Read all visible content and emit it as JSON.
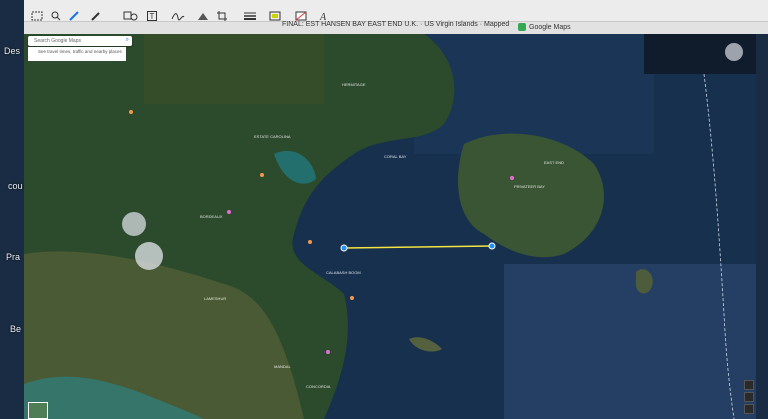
{
  "window": {
    "document_title": "FINAL: EST HANSEN BAY EAST END U.K. · US Virgin Islands · Mapped",
    "browser_tab": "Google Maps"
  },
  "toolbar": {
    "tools": [
      "selection-tool",
      "magnifier-tool",
      "pen-tool",
      "brush-tool",
      "shape-tool",
      "text-tool",
      "sign-tool",
      "adjust-tool",
      "crop-tool",
      "line-style-tool",
      "border-color-tool",
      "fill-color-tool",
      "text-style-tool"
    ]
  },
  "desktop_labels": [
    "Des",
    "cou",
    "Pra",
    "Be"
  ],
  "map": {
    "search_placeholder": "Search Google Maps",
    "search_suggestion": "See travel times, traffic and nearby places",
    "place_labels": [
      "BORDEAUX",
      "HERMITAGE",
      "CALABASH BOOM",
      "MANDAL",
      "CONCORDIA",
      "LAMESHUR",
      "ESTATE CAROLINA",
      "CORAL BAY",
      "PRIVATEER BAY",
      "EAST END"
    ],
    "ruler_line_color": "#f4e542",
    "accent_color": "#1a73e8"
  }
}
